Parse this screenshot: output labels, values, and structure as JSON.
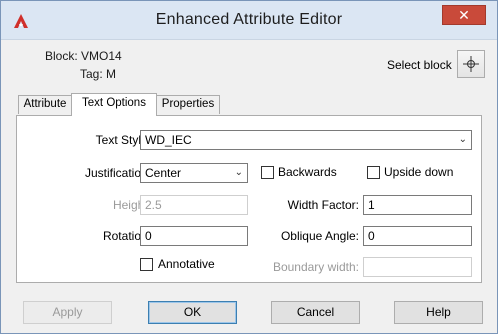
{
  "window": {
    "title": "Enhanced Attribute Editor",
    "close_glyph": "✕"
  },
  "info": {
    "block": "Block: VMO14",
    "tag": "Tag: M"
  },
  "select_block": {
    "label": "Select block",
    "icon": "crosshair-icon"
  },
  "tabs": [
    {
      "label": "Attribute",
      "active": false
    },
    {
      "label": "Text Options",
      "active": true
    },
    {
      "label": "Properties",
      "active": false
    }
  ],
  "form": {
    "text_style": {
      "label": "Text Style:",
      "value": "WD_IEC"
    },
    "justification": {
      "label": "Justification:",
      "value": "Center"
    },
    "backwards": {
      "label": "Backwards",
      "checked": false
    },
    "upside_down": {
      "label": "Upside down",
      "checked": false
    },
    "height": {
      "label": "Height:",
      "value": "2.5",
      "enabled": false
    },
    "width_factor": {
      "label": "Width Factor:",
      "value": "1"
    },
    "rotation": {
      "label": "Rotation:",
      "value": "0"
    },
    "oblique_angle": {
      "label": "Oblique Angle:",
      "value": "0"
    },
    "annotative": {
      "label": "Annotative",
      "checked": false
    },
    "boundary_width": {
      "label": "Boundary width:",
      "value": "",
      "enabled": false
    }
  },
  "buttons": {
    "apply": "Apply",
    "ok": "OK",
    "cancel": "Cancel",
    "help": "Help"
  },
  "colors": {
    "titlebar": "#dbe6f3",
    "close": "#c94a3a",
    "accent_border": "#3c7fb1"
  }
}
